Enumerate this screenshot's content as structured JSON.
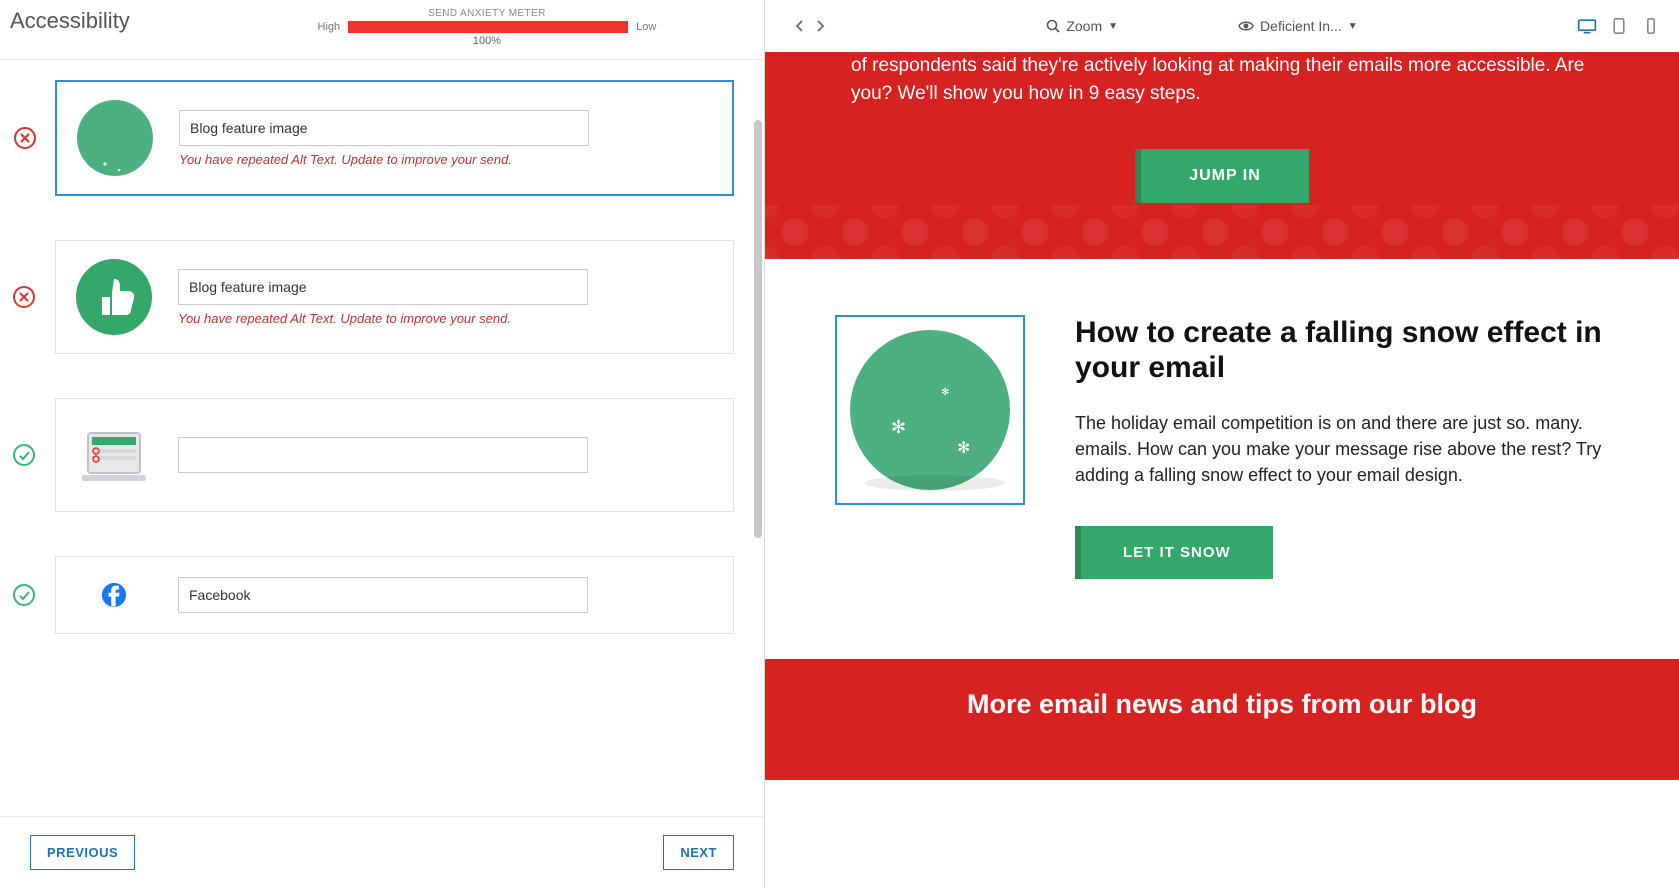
{
  "header": {
    "page_title": "Accessibility",
    "meter": {
      "title": "SEND ANXIETY METER",
      "high_label": "High",
      "low_label": "Low",
      "percent": "100%"
    }
  },
  "colors": {
    "error_red": "#d33",
    "ok_green": "#3cb371",
    "brand_red": "#d72222",
    "brand_green": "#34a86a",
    "accent_blue": "#2f8fd3"
  },
  "cards": [
    {
      "status": "error",
      "thumb": "snow-circle",
      "alt_value": "Blog feature image",
      "warning": "You have repeated Alt Text. Update to improve your send.",
      "selected": true
    },
    {
      "status": "error",
      "thumb": "thumbs-up-circle",
      "alt_value": "Blog feature image",
      "warning": "You have repeated Alt Text. Update to improve your send.",
      "selected": false
    },
    {
      "status": "ok",
      "thumb": "laptop",
      "alt_value": "",
      "warning": "",
      "selected": false
    },
    {
      "status": "ok",
      "thumb": "facebook",
      "alt_value": "Facebook",
      "warning": "",
      "selected": false
    }
  ],
  "footer": {
    "prev_label": "PREVIOUS",
    "next_label": "NEXT"
  },
  "toolbar": {
    "zoom_label": "Zoom",
    "vision_label": "Deficient In..."
  },
  "preview": {
    "hero_text": "of respondents said they're actively looking at making their emails more accessible. Are you? We'll show you how in 9 easy steps.",
    "hero_cta": "JUMP IN",
    "article": {
      "title": "How to create a falling snow effect in your email",
      "desc": "The holiday email competition is on and there are just so. many. emails. How can you make your message rise above the rest? Try adding a falling snow effect to your email design.",
      "cta": "LET IT SNOW"
    },
    "blog_band": "More email news and tips from our blog"
  }
}
